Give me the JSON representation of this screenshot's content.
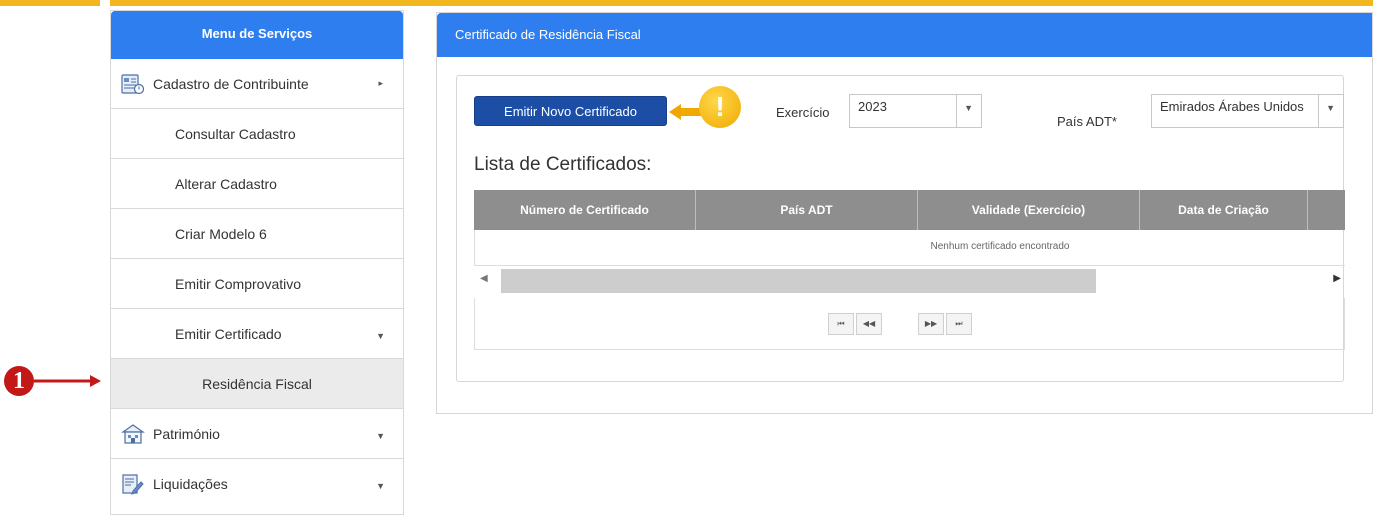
{
  "sidebar": {
    "title": "Menu de Serviços",
    "items": [
      {
        "label": "Cadastro de Contribuinte"
      },
      {
        "label": "Consultar Cadastro"
      },
      {
        "label": "Alterar Cadastro"
      },
      {
        "label": "Criar Modelo 6"
      },
      {
        "label": "Emitir Comprovativo"
      },
      {
        "label": "Emitir Certificado"
      },
      {
        "label": "Residência Fiscal"
      },
      {
        "label": "Património"
      },
      {
        "label": "Liquidações"
      }
    ]
  },
  "annotation": {
    "marker_number": "1",
    "warning_symbol": "!"
  },
  "panel": {
    "title": "Certificado de Residência Fiscal",
    "emit_button": "Emitir Novo Certificado",
    "exercicio_label": "Exercício",
    "exercicio_value": "2023",
    "pais_label": "País ADT*",
    "pais_value": "Emirados Árabes Unidos",
    "list_title": "Lista de Certificados:",
    "columns": [
      "Número de Certificado",
      "País ADT",
      "Validade (Exercício)",
      "Data de Criação"
    ],
    "empty_message": "Nenhum certificado encontrado",
    "pager": {
      "first": "⏮",
      "prev": "◀◀",
      "next": "▶▶",
      "last": "⏭"
    }
  },
  "colors": {
    "accent": "#2f7ef0",
    "button": "#1c4ea6",
    "topbar": "#f2b71f",
    "marker": "#c21818",
    "warning": "#f0a800",
    "header_gray": "#8e8e8e"
  }
}
